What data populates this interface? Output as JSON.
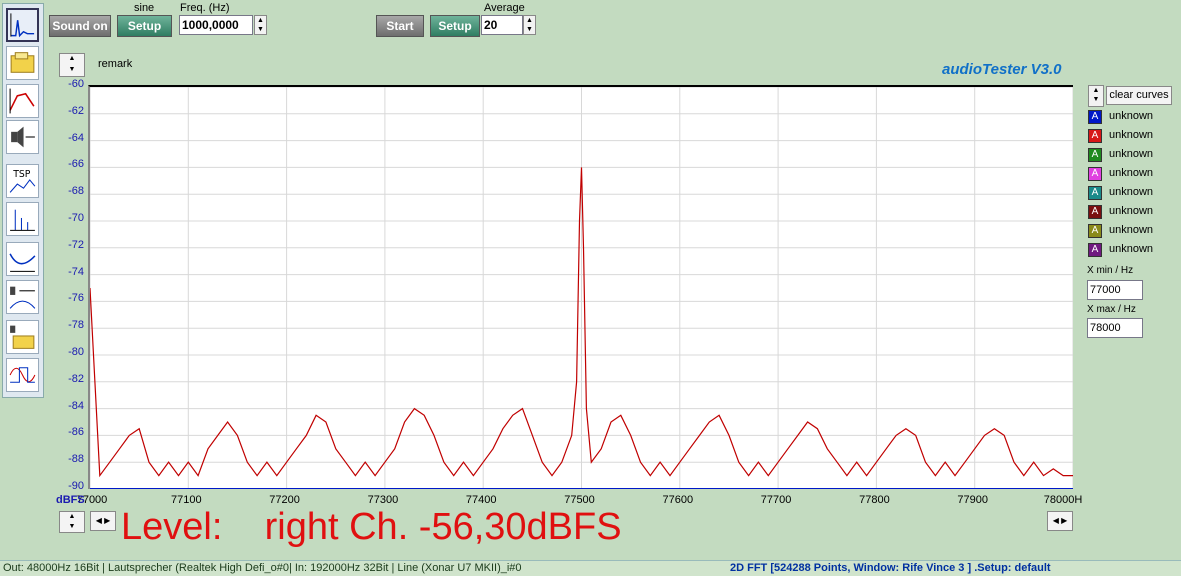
{
  "toolbar": {
    "sound_on_label": "Sound on",
    "setup_label": "Setup",
    "generator_label": "sine",
    "freq_label": "Freq. (Hz)",
    "freq_value": "1000,0000",
    "start_label": "Start",
    "setup2_label": "Setup",
    "average_label": "Average",
    "average_value": "20"
  },
  "remark_label": "remark",
  "app_title": "audioTester  V3.0",
  "legend": {
    "clear_label": "clear curves",
    "items": [
      {
        "letter": "A",
        "color": "#0018c8",
        "label": "unknown"
      },
      {
        "letter": "A",
        "color": "#d81818",
        "label": "unknown"
      },
      {
        "letter": "A",
        "color": "#1f8a1f",
        "label": "unknown"
      },
      {
        "letter": "A",
        "color": "#e040e0",
        "label": "unknown"
      },
      {
        "letter": "A",
        "color": "#1a8a8a",
        "label": "unknown"
      },
      {
        "letter": "A",
        "color": "#7a1010",
        "label": "unknown"
      },
      {
        "letter": "A",
        "color": "#8a8a1a",
        "label": "unknown"
      },
      {
        "letter": "A",
        "color": "#701a80",
        "label": "unknown"
      }
    ],
    "xmin_label": "X min / Hz",
    "xmin_value": "77000",
    "xmax_label": "X max / Hz",
    "xmax_value": "78000"
  },
  "level_text": "Level:    right Ch. -56,30dBFS",
  "status": {
    "left": "Out: 48000Hz 16Bit  | Lautsprecher (Realtek High Defi_o#0|  In: 192000Hz 32Bit  | Line (Xonar U7 MKII)_i#0",
    "right": "2D FFT [524288 Points, Window: Rife Vince 3 ]  .Setup:  default"
  },
  "chart_data": {
    "type": "line",
    "ylabel": "dBFS",
    "xlabel": "",
    "unit_x": "H",
    "xlim": [
      77000,
      78000
    ],
    "ylim": [
      -90,
      -60
    ],
    "x_ticks": [
      "77000",
      "77100",
      "77200",
      "77300",
      "77400",
      "77500",
      "77600",
      "77700",
      "77800",
      "77900",
      "78000H"
    ],
    "y_ticks": [
      "-60",
      "-62",
      "-64",
      "-66",
      "-68",
      "-70",
      "-72",
      "-74",
      "-76",
      "-78",
      "-80",
      "-82",
      "-84",
      "-86",
      "-88",
      "-90"
    ],
    "grid": true,
    "series": [
      {
        "color": "#c00000",
        "x": [
          77000,
          77010,
          77020,
          77030,
          77040,
          77050,
          77060,
          77070,
          77080,
          77090,
          77100,
          77110,
          77120,
          77130,
          77140,
          77150,
          77160,
          77170,
          77180,
          77190,
          77200,
          77210,
          77220,
          77230,
          77240,
          77250,
          77260,
          77270,
          77280,
          77290,
          77300,
          77310,
          77320,
          77330,
          77340,
          77350,
          77360,
          77370,
          77380,
          77390,
          77400,
          77410,
          77420,
          77430,
          77440,
          77450,
          77460,
          77470,
          77480,
          77490,
          77495,
          77498,
          77500,
          77502,
          77505,
          77510,
          77520,
          77530,
          77540,
          77550,
          77560,
          77570,
          77580,
          77590,
          77600,
          77610,
          77620,
          77630,
          77640,
          77650,
          77660,
          77670,
          77680,
          77690,
          77700,
          77710,
          77720,
          77730,
          77740,
          77750,
          77760,
          77770,
          77780,
          77790,
          77800,
          77810,
          77820,
          77830,
          77840,
          77850,
          77860,
          77870,
          77880,
          77890,
          77900,
          77910,
          77920,
          77930,
          77940,
          77950,
          77960,
          77970,
          77980,
          77990,
          78000
        ],
        "y": [
          -75,
          -89,
          -88,
          -87,
          -86,
          -85.5,
          -88,
          -89,
          -88,
          -89,
          -88,
          -89,
          -87,
          -86,
          -85,
          -86,
          -88,
          -89,
          -88,
          -89,
          -88,
          -87,
          -86,
          -84.5,
          -85,
          -87,
          -88,
          -89,
          -88,
          -89,
          -88,
          -87,
          -85,
          -84,
          -84.5,
          -86,
          -88,
          -89,
          -88,
          -89,
          -88,
          -87,
          -85.5,
          -84.5,
          -84,
          -86,
          -88,
          -89,
          -88,
          -86,
          -82,
          -70,
          -66,
          -72,
          -84,
          -88,
          -87,
          -85,
          -84.5,
          -86,
          -88,
          -89,
          -88,
          -89,
          -88,
          -87,
          -86,
          -85,
          -84.5,
          -86,
          -88,
          -89,
          -88,
          -89,
          -88,
          -87,
          -86,
          -85,
          -85.5,
          -87,
          -88,
          -89,
          -88,
          -89,
          -88,
          -87,
          -86,
          -85.5,
          -86,
          -88,
          -89,
          -88,
          -89,
          -88,
          -87,
          -86,
          -85.5,
          -86,
          -88,
          -89,
          -88,
          -89,
          -88.5,
          -89,
          -89
        ]
      },
      {
        "color": "#0018c8",
        "x": [
          77000,
          78000
        ],
        "y": [
          -90,
          -90
        ]
      }
    ]
  }
}
